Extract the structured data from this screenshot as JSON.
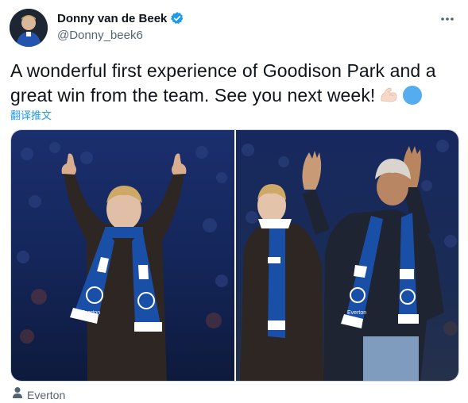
{
  "author": {
    "display_name": "Donny van de Beek",
    "handle": "@Donny_beek6",
    "verified": true
  },
  "tweet": {
    "text": "A wonderful first experience of Goodison Park and a great win from the team. See you next week!",
    "translate_label": "翻译推文"
  },
  "media": {
    "photos": [
      {
        "scarf_text": "Everton"
      },
      {
        "scarf_text": "Everton"
      }
    ]
  },
  "location": {
    "label": "Everton"
  },
  "colors": {
    "accent": "#1d9bf0",
    "everton_blue": "#1a4fa8",
    "text": "#0f1419",
    "secondary": "#536471"
  },
  "icons": {
    "verified": "verified-badge-icon",
    "more": "more-icon",
    "location": "person-icon"
  }
}
